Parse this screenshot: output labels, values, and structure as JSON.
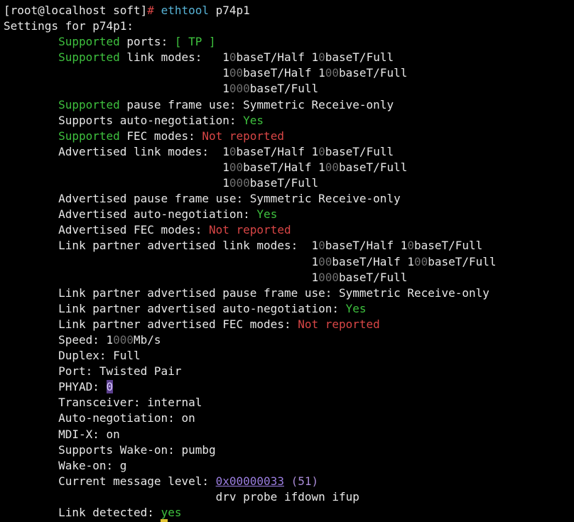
{
  "window": {
    "type": "terminal"
  },
  "colors": {
    "background": "#000000",
    "text": "#e8e8e8",
    "green": "#3ec13e",
    "red": "#d94646",
    "cyan": "#57b3d6",
    "purple": "#a98bd6"
  },
  "terminal": {
    "lines": [
      [
        {
          "t": "[root@localhost soft]"
        },
        {
          "t": "# ",
          "c": "red"
        },
        {
          "t": "ethtool ",
          "c": "cyan"
        },
        {
          "t": "p74p1"
        }
      ],
      [
        {
          "t": "Settings for p74p1:"
        }
      ],
      [
        {
          "t": "        "
        },
        {
          "t": "Supported",
          "c": "green"
        },
        {
          "t": " ports: "
        },
        {
          "t": "[ TP ]",
          "c": "green"
        }
      ],
      [
        {
          "t": "        "
        },
        {
          "t": "Supported",
          "c": "green"
        },
        {
          "t": " link modes:   1"
        },
        {
          "t": "0",
          "c": "zero"
        },
        {
          "t": "baseT/Half 1"
        },
        {
          "t": "0",
          "c": "zero"
        },
        {
          "t": "baseT/Full"
        }
      ],
      [
        {
          "t": "                                1"
        },
        {
          "t": "00",
          "c": "zero"
        },
        {
          "t": "baseT/Half 1"
        },
        {
          "t": "00",
          "c": "zero"
        },
        {
          "t": "baseT/Full"
        }
      ],
      [
        {
          "t": "                                1"
        },
        {
          "t": "000",
          "c": "zero"
        },
        {
          "t": "baseT/Full"
        }
      ],
      [
        {
          "t": "        "
        },
        {
          "t": "Supported",
          "c": "green"
        },
        {
          "t": " pause frame use: Symmetric Receive-only"
        }
      ],
      [
        {
          "t": "        Supports auto-negotiation: "
        },
        {
          "t": "Yes",
          "c": "green"
        }
      ],
      [
        {
          "t": "        "
        },
        {
          "t": "Supported",
          "c": "green"
        },
        {
          "t": " FEC modes: "
        },
        {
          "t": "Not reported",
          "c": "red"
        }
      ],
      [
        {
          "t": "        Advertised link modes:  1"
        },
        {
          "t": "0",
          "c": "zero"
        },
        {
          "t": "baseT/Half 1"
        },
        {
          "t": "0",
          "c": "zero"
        },
        {
          "t": "baseT/Full"
        }
      ],
      [
        {
          "t": "                                1"
        },
        {
          "t": "00",
          "c": "zero"
        },
        {
          "t": "baseT/Half 1"
        },
        {
          "t": "00",
          "c": "zero"
        },
        {
          "t": "baseT/Full"
        }
      ],
      [
        {
          "t": "                                1"
        },
        {
          "t": "000",
          "c": "zero"
        },
        {
          "t": "baseT/Full"
        }
      ],
      [
        {
          "t": "        Advertised pause frame use: Symmetric Receive-only"
        }
      ],
      [
        {
          "t": "        Advertised auto-negotiation: "
        },
        {
          "t": "Yes",
          "c": "green"
        }
      ],
      [
        {
          "t": "        Advertised FEC modes: "
        },
        {
          "t": "Not reported",
          "c": "red"
        }
      ],
      [
        {
          "t": "        Link partner advertised link modes:  1"
        },
        {
          "t": "0",
          "c": "zero"
        },
        {
          "t": "baseT/Half 1"
        },
        {
          "t": "0",
          "c": "zero"
        },
        {
          "t": "baseT/Full"
        }
      ],
      [
        {
          "t": "                                             1"
        },
        {
          "t": "00",
          "c": "zero"
        },
        {
          "t": "baseT/Half 1"
        },
        {
          "t": "00",
          "c": "zero"
        },
        {
          "t": "baseT/Full"
        }
      ],
      [
        {
          "t": "                                             1"
        },
        {
          "t": "000",
          "c": "zero"
        },
        {
          "t": "baseT/Full"
        }
      ],
      [
        {
          "t": "        Link partner advertised pause frame use: Symmetric Receive-only"
        }
      ],
      [
        {
          "t": "        Link partner advertised auto-negotiation: "
        },
        {
          "t": "Yes",
          "c": "green"
        }
      ],
      [
        {
          "t": "        Link partner advertised FEC modes: "
        },
        {
          "t": "Not reported",
          "c": "red"
        }
      ],
      [
        {
          "t": "        Speed: 1"
        },
        {
          "t": "000",
          "c": "zero"
        },
        {
          "t": "Mb/s"
        }
      ],
      [
        {
          "t": "        Duplex: Full"
        }
      ],
      [
        {
          "t": "        Port: Twisted Pair"
        }
      ],
      [
        {
          "t": "        PHYAD: "
        },
        {
          "t": "0",
          "c": "zero-hl"
        }
      ],
      [
        {
          "t": "        Transceiver: internal"
        }
      ],
      [
        {
          "t": "        Auto-negotiation: on"
        }
      ],
      [
        {
          "t": "        MDI-X: on"
        }
      ],
      [
        {
          "t": "        Supports Wake-on: pumbg"
        }
      ],
      [
        {
          "t": "        Wake-on: g"
        }
      ],
      [
        {
          "t": "        Current message level: "
        },
        {
          "t": "0x00000033",
          "c": "hexhl"
        },
        {
          "t": " "
        },
        {
          "t": "(51)",
          "c": "purple"
        }
      ],
      [
        {
          "t": "                               drv probe ifdown ifup"
        }
      ],
      [
        {
          "t": "        Link detected: "
        },
        {
          "t": "yes",
          "c": "green"
        }
      ]
    ]
  }
}
